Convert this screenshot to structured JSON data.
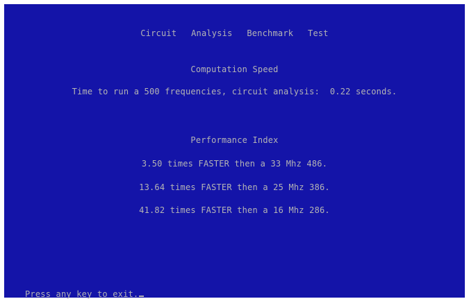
{
  "screen": {
    "title": "Circuit  Analysis  Benchmark  Test",
    "speed_heading": "Computation Speed",
    "speed_text": "Time to run a 500 frequencies, circuit analysis:  0.22 seconds.",
    "performance_heading": "Performance Index",
    "performance_lines": [
      "3.50 times FASTER then a 33 Mhz 486.",
      "13.64 times FASTER then a 25 Mhz 386.",
      "41.82 times FASTER then a 16 Mhz 286."
    ],
    "prompt": "Press any key to exit."
  },
  "colors": {
    "background": "#1414a8",
    "text": "#b4b4b4",
    "frame": "#ffffff"
  }
}
